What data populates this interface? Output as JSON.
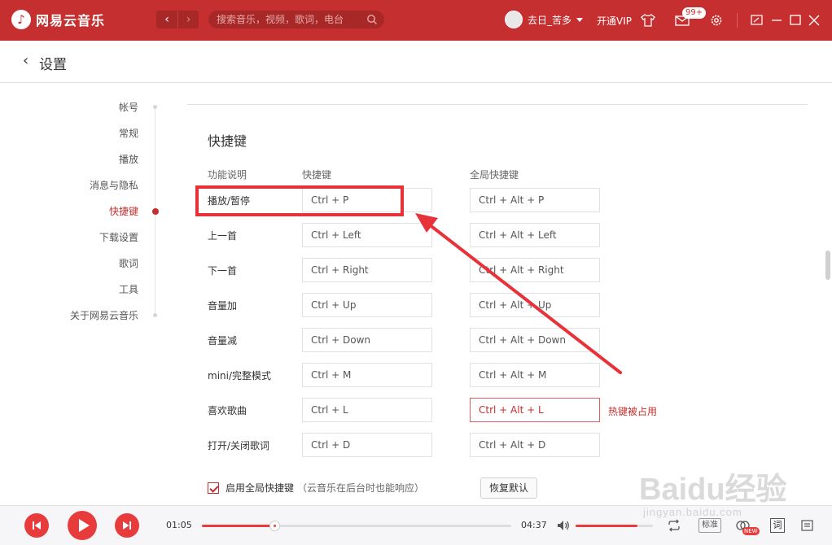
{
  "app": {
    "logo_glyph": "♪",
    "name": "网易云音乐"
  },
  "nav": {
    "back_glyph": "‹",
    "forward_glyph": "›"
  },
  "search": {
    "placeholder": "搜索音乐，视频，歌词，电台"
  },
  "user": {
    "name": "去日_苦多"
  },
  "toolbar": {
    "vip_label": "开通VIP",
    "message_badge": "99+"
  },
  "page": {
    "back_glyph": "‹",
    "title": "设置"
  },
  "sidebar": {
    "items": [
      {
        "label": "帐号",
        "active": false
      },
      {
        "label": "常规",
        "active": false
      },
      {
        "label": "播放",
        "active": false
      },
      {
        "label": "消息与隐私",
        "active": false
      },
      {
        "label": "快捷键",
        "active": true
      },
      {
        "label": "下载设置",
        "active": false
      },
      {
        "label": "歌词",
        "active": false
      },
      {
        "label": "工具",
        "active": false
      },
      {
        "label": "关于网易云音乐",
        "active": false
      }
    ]
  },
  "shortcuts": {
    "title": "快捷键",
    "col_function": "功能说明",
    "col_shortcut": "快捷键",
    "col_global": "全局快捷键",
    "rows": [
      {
        "label": "播放/暂停",
        "key": "Ctrl + P",
        "global": "Ctrl + Alt + P",
        "conflict": false
      },
      {
        "label": "上一首",
        "key": "Ctrl + Left",
        "global": "Ctrl + Alt + Left",
        "conflict": false
      },
      {
        "label": "下一首",
        "key": "Ctrl + Right",
        "global": "Ctrl + Alt + Right",
        "conflict": false
      },
      {
        "label": "音量加",
        "key": "Ctrl + Up",
        "global": "Ctrl + Alt + Up",
        "conflict": false
      },
      {
        "label": "音量减",
        "key": "Ctrl + Down",
        "global": "Ctrl + Alt + Down",
        "conflict": false
      },
      {
        "label": "mini/完整模式",
        "key": "Ctrl + M",
        "global": "Ctrl + Alt + M",
        "conflict": false
      },
      {
        "label": "喜欢歌曲",
        "key": "Ctrl + L",
        "global": "Ctrl + Alt + L",
        "conflict": true
      },
      {
        "label": "打开/关闭歌词",
        "key": "Ctrl + D",
        "global": "Ctrl + Alt + D",
        "conflict": false
      }
    ],
    "conflict_note": "热键被占用",
    "enable_label": "启用全局快捷键",
    "enable_note": "（云音乐在后台时也能响应）",
    "enable_checked": true,
    "restore_label": "恢复默认"
  },
  "player": {
    "prev_glyph": "⏮",
    "play_glyph": "▶",
    "next_glyph": "⏭",
    "current_time": "01:05",
    "total_time": "04:37",
    "progress": 0.235,
    "volume": 0.8,
    "quality_label": "标准",
    "new_badge": "NEW",
    "lyric_label": "词"
  },
  "watermark": {
    "brand": "Baidu经验",
    "url": "jingyan.baidu.com"
  },
  "colors": {
    "accent": "#c62f2f",
    "highlight": "#e8323a",
    "play_red": "#e83c3c"
  }
}
